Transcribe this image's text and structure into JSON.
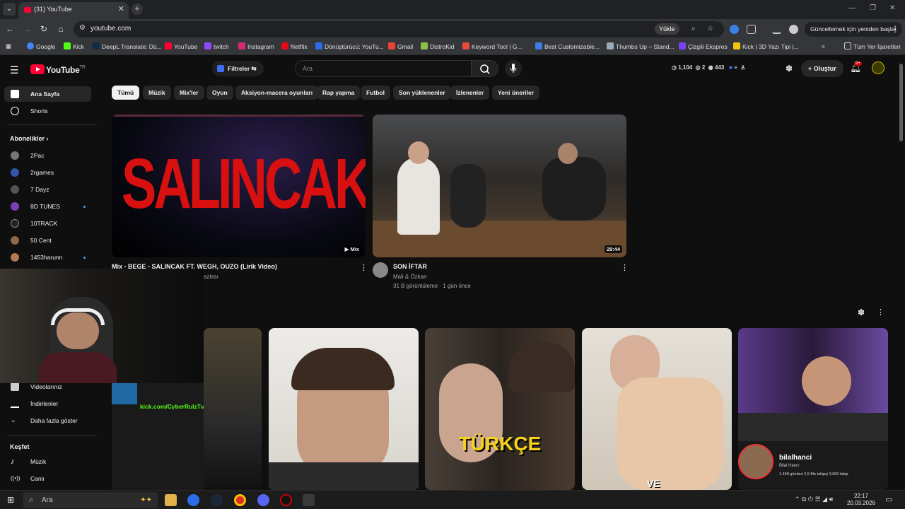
{
  "browser": {
    "tab_title": "(31) YouTube",
    "url": "youtube.com",
    "install_label": "Yükle",
    "update_label": "Güncellemek için yeniden başlat",
    "bookmarks": [
      "Google",
      "Kick",
      "DeepL Translate: Dü...",
      "YouTube",
      "twitch",
      "Instagram",
      "Netflix",
      "Dönüştürücü: YouTu...",
      "Gmail",
      "DistroKid",
      "Keyword Tool | G...",
      "Best Customizable...",
      "Thumbs Up – Stand...",
      "Çizgili Ekspres",
      "Kick | 3D Yazı Tipi |..."
    ],
    "all_bookmarks_label": "Tüm Yer İşaretleri",
    "colors": {
      "accent": "#ff0033",
      "chrome_bg": "#35363a"
    }
  },
  "header": {
    "logo_text": "YouTube",
    "logo_region": "TR",
    "filters_label": "Filtreler",
    "search_placeholder": "Ara",
    "stats": {
      "a": "1,104",
      "b": "2",
      "c": "443"
    },
    "create_label": "Oluştur",
    "notifications_badge": "9+"
  },
  "sidebar": {
    "home": "Ana Sayfa",
    "shorts": "Shorts",
    "subscriptions_heading": "Abonelikler",
    "subscriptions": [
      "2Pac",
      "2rgames",
      "7 Dayz",
      "8D TUNES",
      "10TRACK",
      "50 Cent",
      "1453harunn"
    ],
    "videos_label": "Videolarınız",
    "downloads_label": "İndirilenler",
    "show_more": "Daha fazla göster",
    "explore_heading": "Keşfet",
    "music": "Müzik",
    "live": "Canlı"
  },
  "chips": [
    "Tümü",
    "Müzik",
    "Mix'ler",
    "Oyun",
    "Aksiyon-macera oyunları",
    "Rap yapma",
    "Futbol",
    "Son yüklenenler",
    "İzlenenler",
    "Yeni öneriler"
  ],
  "videos": [
    {
      "thumb_text": "SALINCAK",
      "badge": "Mix",
      "title": "Mix - BEGE - SALINCAK FT. WEGH, OUZO (Lirik Video)",
      "meta": "azlası"
    },
    {
      "duration": "28:44",
      "title": "SON İFTAR",
      "channel": "Mali & Özkan",
      "meta": "31 B görüntüleme · 1 gün önce"
    }
  ],
  "overlay": {
    "kick_url": "kick.com/CyberRulzTv"
  },
  "shorts": [
    {
      "caption": ""
    },
    {
      "caption": ""
    },
    {
      "caption": "TÜRKÇE"
    },
    {
      "caption": "VE"
    },
    {
      "profile_name": "bilalhanci",
      "profile_sub": "Bilal Hancı",
      "profile_stats": "1.458 gönderi   2,5 Mn takipçi   3.050 takip"
    }
  ],
  "taskbar": {
    "search_label": "Ara",
    "time": "22:17",
    "date": "20.03.2026"
  }
}
